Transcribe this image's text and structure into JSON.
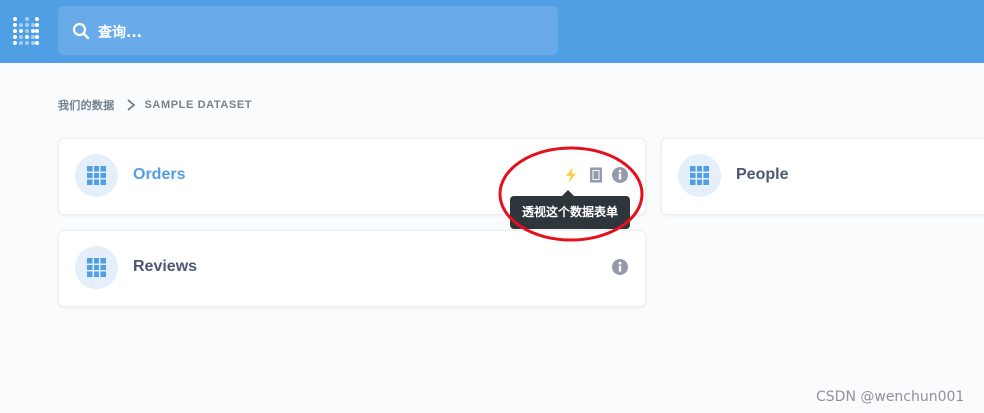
{
  "colors": {
    "topbar": "#509ee3",
    "accent": "#509ee3",
    "text": "#4c5773",
    "muted": "#74838f",
    "bolt": "#f9cf48",
    "tooltip_bg": "#2e353b",
    "annotation": "#e5101c"
  },
  "header": {
    "logo_icon": "metabase-logo-icon",
    "search": {
      "placeholder": "查询...",
      "icon": "search-icon"
    }
  },
  "breadcrumb": {
    "home": "我们的数据",
    "separator_icon": "chevron-right-icon",
    "current": "SAMPLE DATASET"
  },
  "tables": [
    {
      "label": "Orders",
      "icon": "table-grid-icon",
      "actions": [
        "bolt-icon",
        "reference-book-icon",
        "info-icon"
      ]
    },
    {
      "label": "People",
      "icon": "table-grid-icon"
    },
    {
      "label": "Reviews",
      "icon": "table-grid-icon",
      "actions": [
        "info-icon"
      ]
    }
  ],
  "tooltip": {
    "text": "透视这个数据表单"
  },
  "watermark": "CSDN @wenchun001"
}
